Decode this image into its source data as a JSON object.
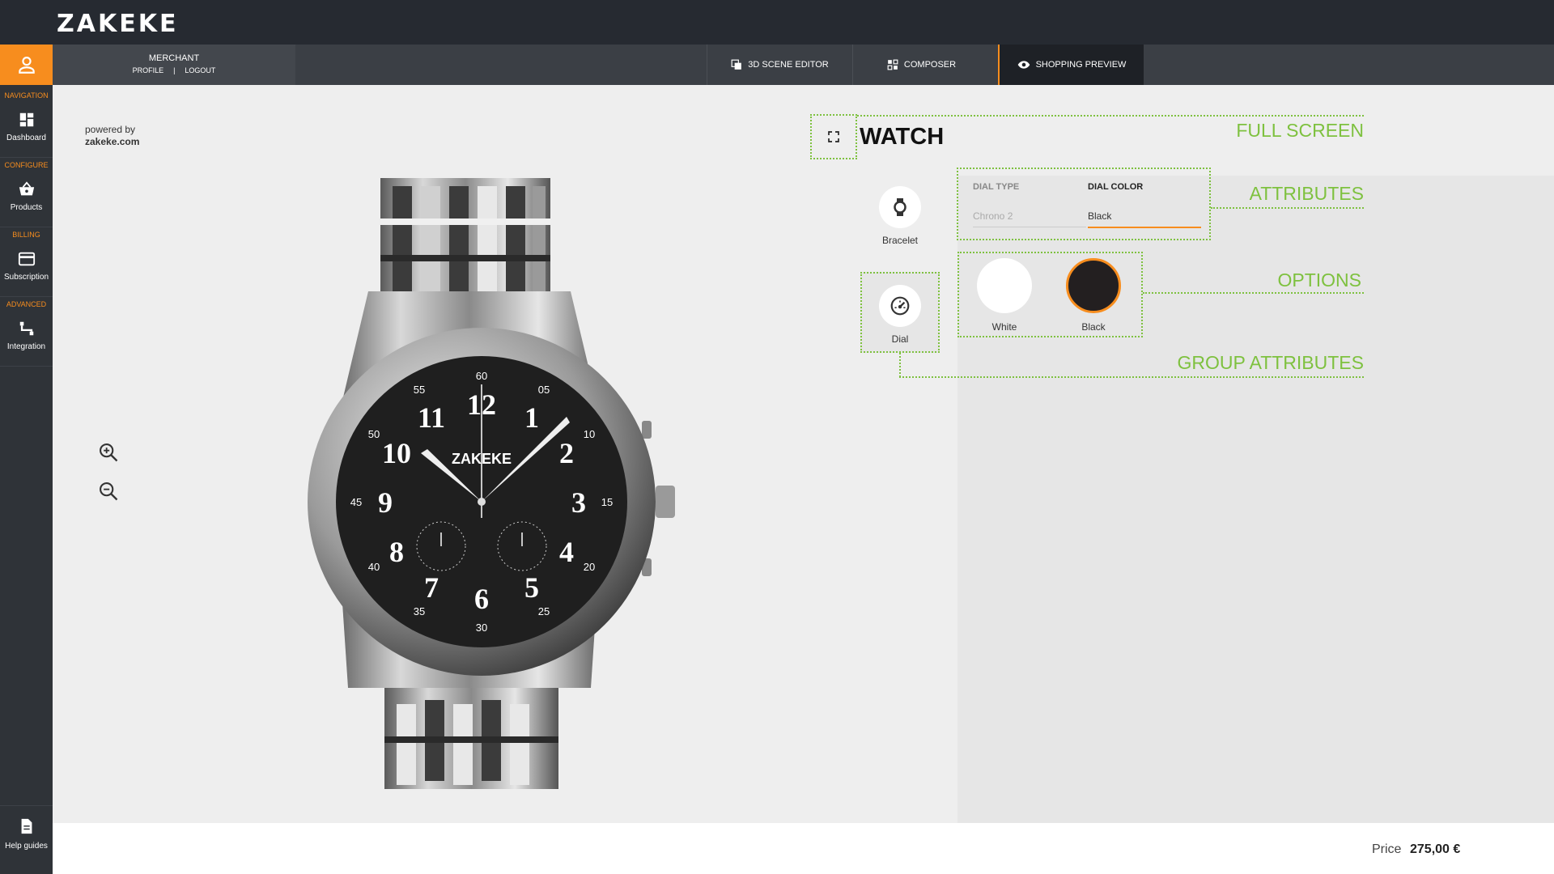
{
  "brand": {
    "logo_text": "ZAKEKE"
  },
  "header": {
    "merchant": "MERCHANT",
    "profile_link": "PROFILE",
    "separator": "|",
    "logout_link": "LOGOUT"
  },
  "modes": [
    {
      "label": "3D SCENE EDITOR",
      "icon": "layers-icon",
      "active": false
    },
    {
      "label": "COMPOSER",
      "icon": "composer-icon",
      "active": false
    },
    {
      "label": "SHOPPING PREVIEW",
      "icon": "eye-icon",
      "active": true
    }
  ],
  "sidebar": {
    "sections": [
      "NAVIGATION",
      "CONFIGURE",
      "BILLING",
      "ADVANCED"
    ],
    "items": [
      {
        "label": "Dashboard",
        "icon": "dashboard-icon"
      },
      {
        "label": "Products",
        "icon": "basket-icon"
      },
      {
        "label": "Subscription",
        "icon": "credit-card-icon"
      },
      {
        "label": "Integration",
        "icon": "integration-icon"
      }
    ],
    "help": "Help guides"
  },
  "preview": {
    "powered_by": "powered by",
    "powered_domain": "zakeke.com",
    "product_title": "WATCH"
  },
  "watch_face": {
    "logo": "ZAKEKE",
    "hours": [
      "12",
      "1",
      "2",
      "3",
      "4",
      "5",
      "6",
      "7",
      "8",
      "9",
      "10",
      "11"
    ],
    "minutes": [
      "60",
      "05",
      "10",
      "15",
      "20",
      "25",
      "30",
      "35",
      "40",
      "45",
      "50",
      "55"
    ]
  },
  "groups": [
    {
      "label": "Bracelet",
      "icon": "watch-icon",
      "selected": false
    },
    {
      "label": "Dial",
      "icon": "speedometer-icon",
      "selected": true
    }
  ],
  "attributes": [
    {
      "name": "DIAL TYPE",
      "value": "Chrono 2",
      "active": false
    },
    {
      "name": "DIAL COLOR",
      "value": "Black",
      "active": true
    }
  ],
  "options": [
    {
      "label": "White",
      "color": "#ffffff",
      "selected": false
    },
    {
      "label": "Black",
      "color": "#231f20",
      "selected": true
    }
  ],
  "annotations": {
    "full_screen": "FULL SCREEN",
    "attributes": "ATTRIBUTES",
    "options": "OPTIONS",
    "group_attributes": "GROUP ATTRIBUTES"
  },
  "footer": {
    "price_label": "Price",
    "price_value": "275,00 €"
  },
  "colors": {
    "accent": "#f78d1e",
    "annotation": "#7ec13f",
    "topbar": "#262a31"
  }
}
